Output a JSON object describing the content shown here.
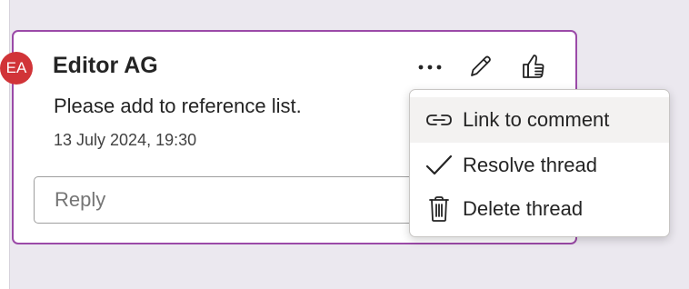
{
  "comment": {
    "avatar_initials": "EA",
    "avatar_color": "#d13438",
    "author": "Editor AG",
    "text": "Please add to reference list.",
    "timestamp": "13 July 2024, 19:30",
    "accent_color": "#9b4aa8",
    "reply": {
      "placeholder": "Reply",
      "value": ""
    },
    "actions": [
      {
        "icon": "more-icon"
      },
      {
        "icon": "pencil-icon"
      },
      {
        "icon": "thumbs-up-icon"
      }
    ]
  },
  "menu": {
    "items": [
      {
        "label": "Link to comment",
        "icon": "link-icon",
        "highlighted": true
      },
      {
        "label": "Resolve thread",
        "icon": "checkmark-icon"
      },
      {
        "label": "Delete thread",
        "icon": "trash-icon"
      }
    ]
  }
}
